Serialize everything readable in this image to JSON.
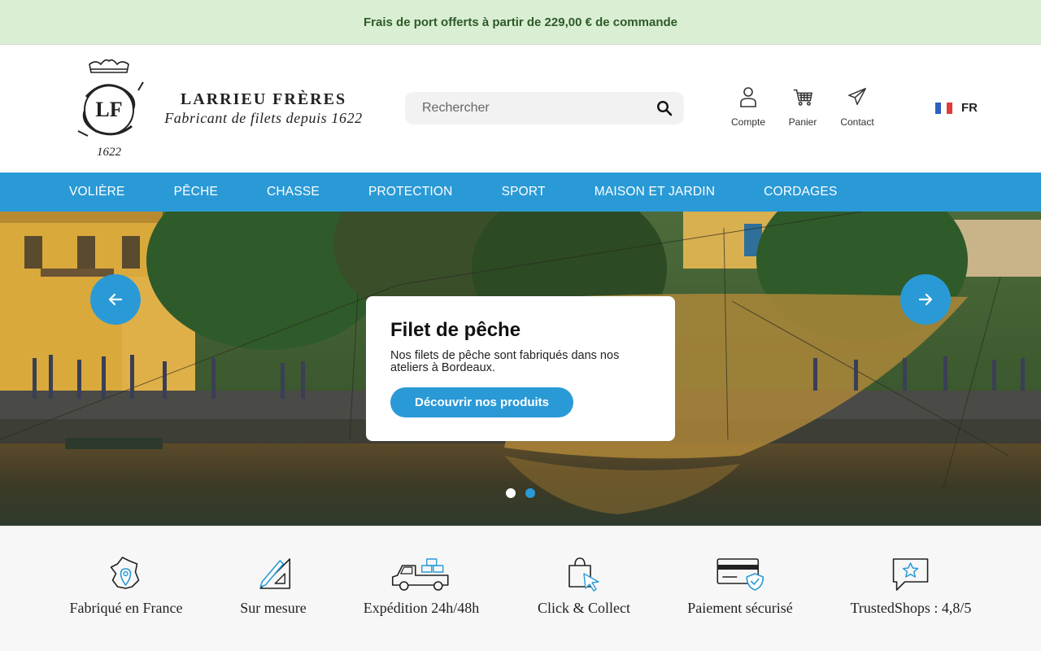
{
  "announcement": "Frais de port offerts à partir de 229,00 € de commande",
  "brand": {
    "name": "LARRIEU FRÈRES",
    "tagline": "Fabricant de filets depuis 1622",
    "logo_initials": "LF",
    "logo_year": "1622"
  },
  "search": {
    "placeholder": "Rechercher"
  },
  "user_actions": [
    {
      "label": "Compte",
      "icon": "user-icon"
    },
    {
      "label": "Panier",
      "icon": "cart-icon"
    },
    {
      "label": "Contact",
      "icon": "paper-plane-icon"
    }
  ],
  "language": {
    "code": "FR",
    "flag": [
      "#2f5fbf",
      "#ffffff",
      "#e33a3a"
    ]
  },
  "nav": [
    "VOLIÈRE",
    "PÊCHE",
    "CHASSE",
    "PROTECTION",
    "SPORT",
    "MAISON ET JARDIN",
    "CORDAGES"
  ],
  "hero": {
    "title": "Filet de pêche",
    "text": "Nos filets de pêche sont fabriqués dans nos ateliers à Bordeaux.",
    "cta": "Découvrir nos produits",
    "slides": 2,
    "active_slide": 2
  },
  "features": [
    {
      "label": "Fabriqué en France",
      "icon": "france-map-pin-icon"
    },
    {
      "label": "Sur mesure",
      "icon": "pencil-ruler-icon"
    },
    {
      "label": "Expédition 24h/48h",
      "icon": "delivery-truck-icon"
    },
    {
      "label": "Click & Collect",
      "icon": "shopping-bag-cursor-icon"
    },
    {
      "label": "Paiement sécurisé",
      "icon": "credit-card-shield-icon"
    },
    {
      "label": "TrustedShops : 4,8/5",
      "icon": "star-speech-bubble-icon"
    }
  ],
  "colors": {
    "accent": "#2a9ad6",
    "announcement_bg": "#d9eed2",
    "announcement_text": "#2e5a2a"
  }
}
